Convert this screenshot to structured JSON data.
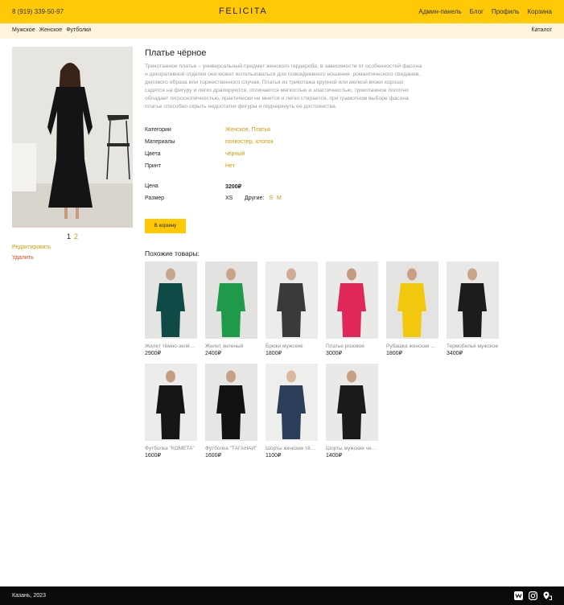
{
  "header": {
    "phone": "8 (919) 339-50-97",
    "logo": "FELICITA",
    "nav": [
      "Админ-панель",
      "Блог",
      "Профиль",
      "Корзина"
    ]
  },
  "categories_bar": {
    "items": [
      "Мужское",
      "Женское",
      "Футболки"
    ],
    "catalog": "Каталог"
  },
  "product": {
    "title": "Платье чёрное",
    "description": "Трикотажное платье – универсальный предмет женского гардероба, в зависимости от особенностей фасона и декоративной отделки оно может использоваться для повседневного ношения, романтического свидания, делового образа или торжественного случая. Платья из трикотажа крупной или мелкой вязки хорошо садятся на фигуру и легко драпируются, отличаются мягкостью и эластичностью, трикотажное полотно обладает гигроскопичностью, практически не мнется и легко стирается, при грамотном выборе фасона платье способно скрыть недостатки фигуры и подчеркнуть ее достоинства.",
    "props": [
      {
        "label": "Категории",
        "value": "Женское, Платья"
      },
      {
        "label": "Материалы",
        "value": "полиэстер, хлопок"
      },
      {
        "label": "Цвета",
        "value": "чёрный"
      },
      {
        "label": "Принт",
        "value": "Нет"
      }
    ],
    "price_label": "Цена",
    "price": "3200₽",
    "size_label": "Размер",
    "size_current": "XS",
    "size_others_label": "Другие:",
    "size_options": [
      "S",
      "M"
    ],
    "cart_button": "В корзину",
    "pager": {
      "current": "1",
      "other": "2"
    },
    "edit": "Редактировать",
    "delete": "Удалить"
  },
  "similar": {
    "title": "Похожие товары:",
    "items": [
      {
        "name": "Жилет тёмно-зелёный",
        "price": "2900₽",
        "image": "model-dark-green-vest",
        "bg": "#e4e4e2",
        "cloth": "#0f4a47",
        "skin": "#c9a58b"
      },
      {
        "name": "Жилет зеленый",
        "price": "2400₽",
        "image": "model-green-vest",
        "bg": "#e2e2e0",
        "cloth": "#1f9a4b",
        "skin": "#caa48a"
      },
      {
        "name": "Брюки мужские",
        "price": "1800₽",
        "image": "model-printed-trousers",
        "bg": "#ececec",
        "cloth": "#3a3a3a",
        "skin": "#d0ad94"
      },
      {
        "name": "Платье розовое",
        "price": "3000₽",
        "image": "model-pink-dress",
        "bg": "#e9e9e7",
        "cloth": "#e0275a",
        "skin": "#c49a7e"
      },
      {
        "name": "Рубашка женская желтая",
        "price": "1800₽",
        "image": "model-yellow-shirt",
        "bg": "#e3e3e1",
        "cloth": "#f2c80f",
        "skin": "#c9a086"
      },
      {
        "name": "Термобельё мужское",
        "price": "3400₽",
        "image": "model-black-thermal",
        "bg": "#e8e8e6",
        "cloth": "#1c1c1c",
        "skin": "#caa48a"
      },
      {
        "name": "Футболка \"КОМЕТА\"",
        "price": "1600₽",
        "image": "model-black-tshirt-cometa",
        "bg": "#ececec",
        "cloth": "#151515",
        "skin": "#c59d82"
      },
      {
        "name": "Футболка \"ТАГАНАЙ\"",
        "price": "1600₽",
        "image": "model-black-tshirt-taganay",
        "bg": "#e6e6e4",
        "cloth": "#111111",
        "skin": "#c9a086"
      },
      {
        "name": "Шорты женские тёмно-синие",
        "price": "1100₽",
        "image": "model-printed-shorts",
        "bg": "#eeeeec",
        "cloth": "#2b3f5a",
        "skin": "#d9b9a0"
      },
      {
        "name": "Шорты мужские черные",
        "price": "1400₽",
        "image": "model-black-shorts",
        "bg": "#e9e9e7",
        "cloth": "#1a1a1a",
        "skin": "#c8a085"
      }
    ]
  },
  "footer": {
    "city": "Казань, 2023",
    "icons": [
      "vk-icon",
      "instagram-icon",
      "map-pin-icon"
    ]
  },
  "colors": {
    "accent": "#ffc907",
    "link": "#d59a00",
    "danger": "#d6451f",
    "footer": "#0b0b0b"
  }
}
